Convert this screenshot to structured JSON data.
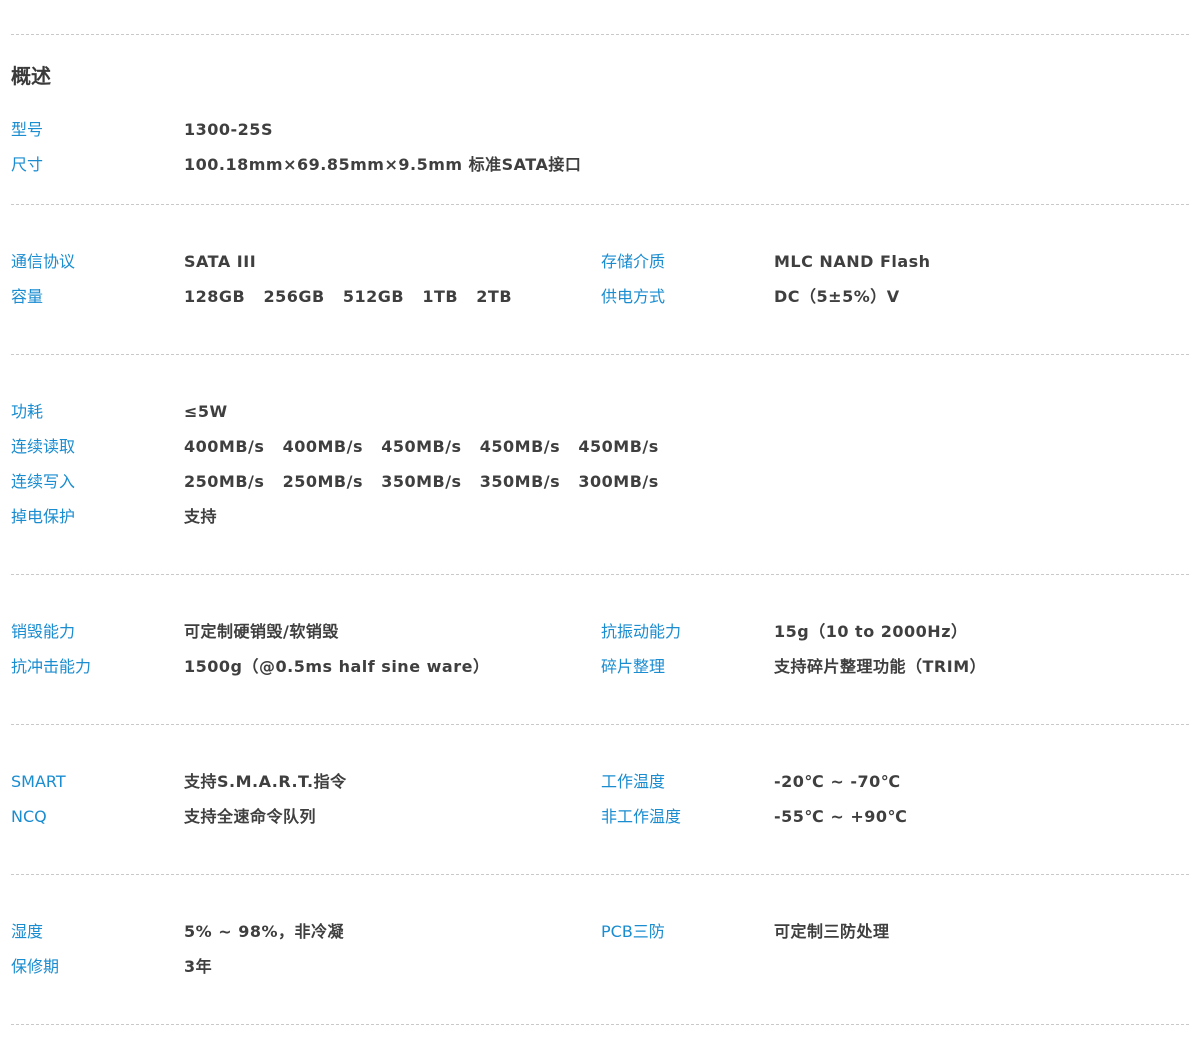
{
  "heading": "概述",
  "rows": {
    "model": {
      "label": "型号",
      "value": "1300-25S"
    },
    "size": {
      "label": "尺寸",
      "value": "100.18mm×69.85mm×9.5mm 标准SATA接口"
    },
    "protocol": {
      "label": "通信协议",
      "value": "SATA III"
    },
    "storage_medium": {
      "label": "存储介质",
      "value": "MLC NAND Flash"
    },
    "capacity": {
      "label": "容量",
      "value": "128GB   256GB   512GB   1TB   2TB"
    },
    "power_supply": {
      "label": "供电方式",
      "value": "DC（5±5%）V"
    },
    "power_consumption": {
      "label": "功耗",
      "value": "≤5W"
    },
    "seq_read": {
      "label": "连续读取",
      "value": "400MB/s   400MB/s   450MB/s   450MB/s   450MB/s"
    },
    "seq_write": {
      "label": "连续写入",
      "value": "250MB/s   250MB/s   350MB/s   350MB/s   300MB/s"
    },
    "power_loss_protection": {
      "label": "掉电保护",
      "value": "支持"
    },
    "destruction": {
      "label": "销毁能力",
      "value": "可定制硬销毁/软销毁"
    },
    "vibration": {
      "label": "抗振动能力",
      "value": "15g（10 to 2000Hz）"
    },
    "shock": {
      "label": "抗冲击能力",
      "value": "1500g（@0.5ms half sine ware）"
    },
    "defrag": {
      "label": "碎片整理",
      "value": "支持碎片整理功能（TRIM）"
    },
    "smart": {
      "label": "SMART",
      "value": "支持S.M.A.R.T.指令"
    },
    "operating_temp": {
      "label": "工作温度",
      "value": "-20℃ ~ -70℃"
    },
    "ncq": {
      "label": "NCQ",
      "value": "支持全速命令队列"
    },
    "non_operating_temp": {
      "label": "非工作温度",
      "value": "-55℃ ~ +90℃"
    },
    "humidity": {
      "label": "湿度",
      "value": "5% ~ 98%，非冷凝"
    },
    "pcb_protection": {
      "label": "PCB三防",
      "value": "可定制三防处理"
    },
    "warranty": {
      "label": "保修期",
      "value": "3年"
    }
  },
  "colors": {
    "label": "#1a8cd0",
    "value": "#3f3f3f",
    "heading": "#3a3a3a",
    "divider": "#c9c9c9"
  }
}
